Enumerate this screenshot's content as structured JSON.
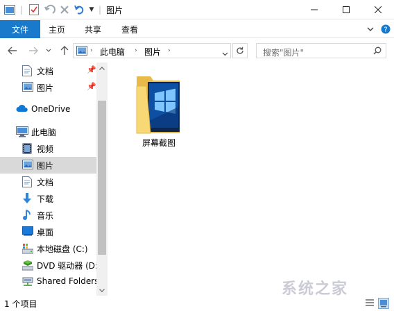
{
  "window": {
    "title": "图片"
  },
  "ribbon": {
    "tabs": [
      "文件",
      "主页",
      "共享",
      "查看"
    ]
  },
  "address": {
    "segments": [
      "此电脑",
      "图片"
    ]
  },
  "search": {
    "placeholder": "搜索\"图片\""
  },
  "nav": {
    "quick_access": [
      {
        "label": "文档",
        "icon": "document-icon",
        "pinned": true
      },
      {
        "label": "图片",
        "icon": "pictures-icon",
        "pinned": true
      }
    ],
    "onedrive": {
      "label": "OneDrive",
      "icon": "cloud-icon"
    },
    "this_pc": {
      "label": "此电脑",
      "icon": "computer-icon",
      "children": [
        {
          "label": "视频",
          "icon": "video-icon"
        },
        {
          "label": "图片",
          "icon": "pictures-icon",
          "selected": true
        },
        {
          "label": "文档",
          "icon": "document-icon"
        },
        {
          "label": "下载",
          "icon": "download-icon"
        },
        {
          "label": "音乐",
          "icon": "music-icon"
        },
        {
          "label": "桌面",
          "icon": "desktop-icon"
        },
        {
          "label": "本地磁盘 (C:)",
          "icon": "drive-icon"
        },
        {
          "label": "DVD 驱动器 (D:",
          "icon": "dvd-icon"
        },
        {
          "label": "Shared Folders",
          "icon": "network-icon"
        }
      ]
    }
  },
  "content": {
    "items": [
      {
        "label": "屏幕截图",
        "type": "folder"
      }
    ]
  },
  "status": {
    "text": "1 个项目"
  },
  "watermark": {
    "text": "系统之家"
  },
  "colors": {
    "accent": "#1979ca",
    "selection": "#d9d9d9",
    "folder": "#f8d775"
  }
}
